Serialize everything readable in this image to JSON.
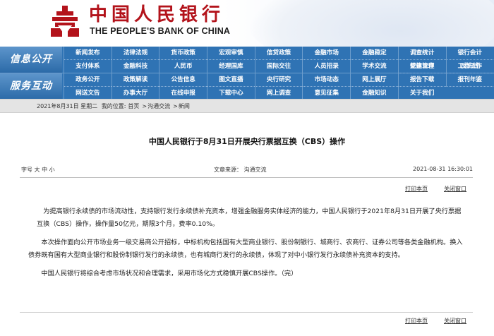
{
  "header": {
    "logo_cn": "中国人民银行",
    "logo_en": "THE PEOPLE'S BANK OF CHINA",
    "colors": {
      "logo_red": "#b3131b",
      "nav_blue": "#2f73b4"
    }
  },
  "nav": {
    "groups": [
      {
        "label": "信息公开",
        "items": [
          "新闻发布",
          "法律法规",
          "货币政策",
          "宏观审慎",
          "信贷政策",
          "金融市场",
          "金融稳定",
          "调查统计",
          "银行会计",
          "支付体系",
          "金融科技",
          "人民币",
          "经理国库",
          "国际交往",
          "人员招录",
          "学术交流",
          "征信管理",
          "反洗钱"
        ]
      },
      {
        "label": "服务互动",
        "items": [
          "党建工作",
          "工会工作",
          "政务公开",
          "政策解读",
          "公告信息",
          "图文直播",
          "央行研究",
          "市场动态",
          "网上展厅",
          "报告下载",
          "报刊年鉴",
          "网送文告",
          "办事大厅",
          "在线申报",
          "下载中心",
          "网上调查",
          "意见征集",
          "金融知识",
          "关于我们"
        ]
      }
    ]
  },
  "breadcrumb": {
    "date": "2021年8月31日 星期二",
    "prefix": "我的位置:",
    "path": [
      "首页",
      "沟通交流",
      "新闻"
    ],
    "separator": ">"
  },
  "article": {
    "title": "中国人民银行于8月31日开展央行票据互换（CBS）操作",
    "font_size_label": "字号",
    "font_sizes": [
      "大",
      "中",
      "小"
    ],
    "source_label": "文章来源：",
    "source": "沟通交流",
    "date": "2021-08-31 16:30:01",
    "print_label": "打印本页",
    "close_label": "关闭窗口",
    "paragraphs": [
      "为提高银行永续债的市场流动性，支持银行发行永续债补充资本，增强金融服务实体经济的能力，中国人民银行于2021年8月31日开展了央行票据互换（CBS）操作，操作量50亿元，期限3个月，费率0.10%。",
      "本次操作面向公开市场业务一级交易商公开招标，中标机构包括国有大型商业银行、股份制银行、城商行、农商行、证券公司等各类金融机构。换入债券既有国有大型商业银行和股份制银行发行的永续债，也有城商行发行的永续债，体现了对中小银行发行永续债补充资本的支持。",
      "中国人民银行将综合考虑市场状况和合理需求，采用市场化方式稳慎开展CBS操作。（完）"
    ]
  }
}
